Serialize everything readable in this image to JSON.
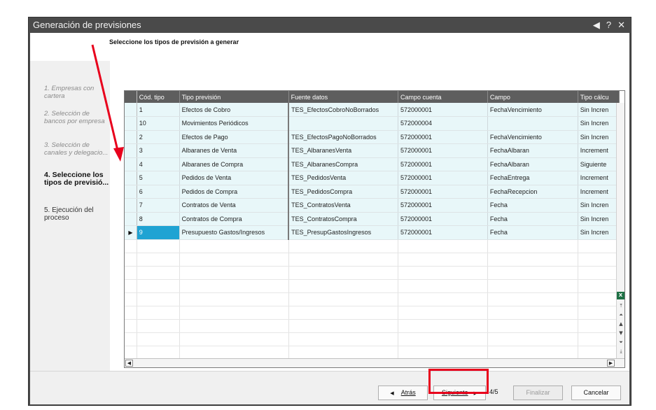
{
  "window": {
    "title": "Generación de previsiones",
    "controls": [
      "◀",
      "?",
      "✕"
    ]
  },
  "heading": "Seleccione los tipos de previsión a generar",
  "steps": [
    {
      "label": "1. Empresas con cartera",
      "state": "done"
    },
    {
      "label": "2. Selección de bancos por empresa",
      "state": "done"
    },
    {
      "label": "3. Selección de canales y delegacio...",
      "state": "done"
    },
    {
      "label": "4. Seleccione los tipos de previsió...",
      "state": "active"
    },
    {
      "label": "5. Ejecución del proceso",
      "state": "future"
    }
  ],
  "grid": {
    "columns": [
      "Cód. tipo",
      "Tipo previsión",
      "Fuente datos",
      "Campo cuenta",
      "Campo",
      "Tipo cálcu"
    ],
    "rows": [
      [
        "1",
        "Efectos de Cobro",
        "TES_EfectosCobroNoBorrados",
        "572000001",
        "FechaVencimiento",
        "Sin Incren"
      ],
      [
        "10",
        "Movimientos Periódicos",
        "",
        "572000004",
        "",
        "Sin Incren"
      ],
      [
        "2",
        "Efectos de Pago",
        "TES_EfectosPagoNoBorrados",
        "572000001",
        "FechaVencimiento",
        "Sin Incren"
      ],
      [
        "3",
        "Albaranes de Venta",
        "TES_AlbaranesVenta",
        "572000001",
        "FechaAlbaran",
        "Increment"
      ],
      [
        "4",
        "Albaranes de Compra",
        "TES_AlbaranesCompra",
        "572000001",
        "FechaAlbaran",
        "Siguiente"
      ],
      [
        "5",
        "Pedidos de Venta",
        "TES_PedidosVenta",
        "572000001",
        "FechaEntrega",
        "Increment"
      ],
      [
        "6",
        "Pedidos de Compra",
        "TES_PedidosCompra",
        "572000001",
        "FechaRecepcion",
        "Increment"
      ],
      [
        "7",
        "Contratos de Venta",
        "TES_ContratosVenta",
        "572000001",
        "Fecha",
        "Sin Incren"
      ],
      [
        "8",
        "Contratos de Compra",
        "TES_ContratosCompra",
        "572000001",
        "Fecha",
        "Sin Incren"
      ],
      [
        "9",
        "Presupuesto Gastos/Ingresos",
        "TES_PresupGastosIngresos",
        "572000001",
        "Fecha",
        "Sin Incren"
      ]
    ],
    "current_row": 9,
    "current_indicator": "▶"
  },
  "footer": {
    "back_label": "Atrás",
    "next_label": "Siguiente",
    "page_count": "4/5",
    "finish_label": "Finalizar",
    "cancel_label": "Cancelar"
  },
  "colors": {
    "annotation": "#e8001c",
    "selected_cell": "#1fa3d3",
    "row_tint": "#e8f7f9"
  }
}
